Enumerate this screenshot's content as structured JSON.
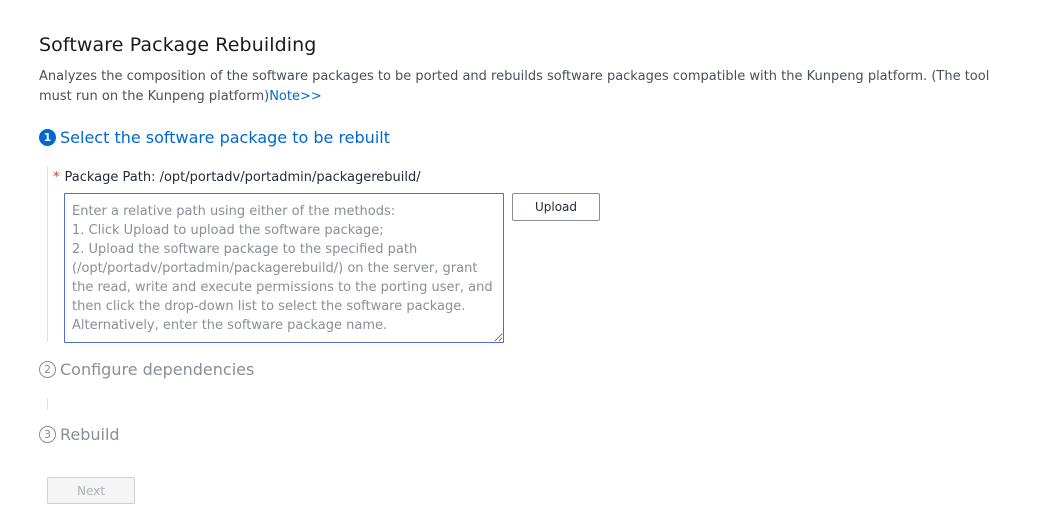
{
  "page": {
    "title": "Software Package Rebuilding",
    "description": "Analyzes the composition of the software packages to be ported and rebuilds software packages compatible with the Kunpeng platform. (The tool must run on the Kunpeng platform)",
    "note_link": "Note>>"
  },
  "steps": [
    {
      "number": "1",
      "label": "Select the software package to be rebuilt",
      "state": "active"
    },
    {
      "number": "2",
      "label": "Configure dependencies",
      "state": "inactive"
    },
    {
      "number": "3",
      "label": "Rebuild",
      "state": "inactive"
    }
  ],
  "package_path": {
    "required_mark": "*",
    "label": "Package Path: /opt/portadv/portadmin/packagerebuild/",
    "placeholder": "Enter a relative path using either of the methods:\n1. Click Upload to upload the software package;\n2. Upload the software package to the specified path (/opt/portadv/portadmin/packagerebuild/) on the server, grant the read, write and execute permissions to the porting user, and then click the drop-down list to select the software package. Alternatively, enter the software package name.",
    "value": ""
  },
  "buttons": {
    "upload": "Upload",
    "next": "Next"
  },
  "colors": {
    "accent": "#0067d1",
    "required": "#e0342a",
    "inactive_text": "#8a8e99",
    "input_border": "#526ecc"
  }
}
